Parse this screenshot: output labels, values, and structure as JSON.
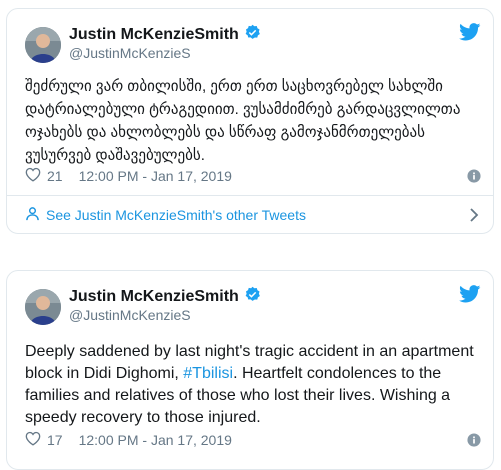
{
  "tweets": [
    {
      "name": "Justin McKenzieSmith",
      "handle": "@JustinMcKenzieS",
      "text": "შეძრული ვარ თბილისში, ერთ ერთ საცხოვრებელ სახლში დატრიალებული ტრაგედიით. ვუსამძიმრებ გარდაცვლილთა ოჯახებს და ახლობლებს და სწრაფ გამოჯანმრთელებას ვუსურვებ დაშავებულებს.",
      "likes": "21",
      "timestamp": "12:00 PM - Jan 17, 2019",
      "see_more": "See Justin McKenzieSmith's other Tweets"
    },
    {
      "name": "Justin McKenzieSmith",
      "handle": "@JustinMcKenzieS",
      "text_before": "Deeply saddened by last night's tragic accident in an apartment block in Didi Dighomi, ",
      "hashtag": "#Tbilisi",
      "text_after": ". Heartfelt condolences to the families and relatives of those who lost their lives. Wishing a speedy recovery to those injured.",
      "likes": "17",
      "timestamp": "12:00 PM - Jan 17, 2019"
    }
  ],
  "colors": {
    "accent": "#1b95e0",
    "verified": "#1da1f2",
    "muted": "#657786",
    "border": "#e1e8ed"
  }
}
